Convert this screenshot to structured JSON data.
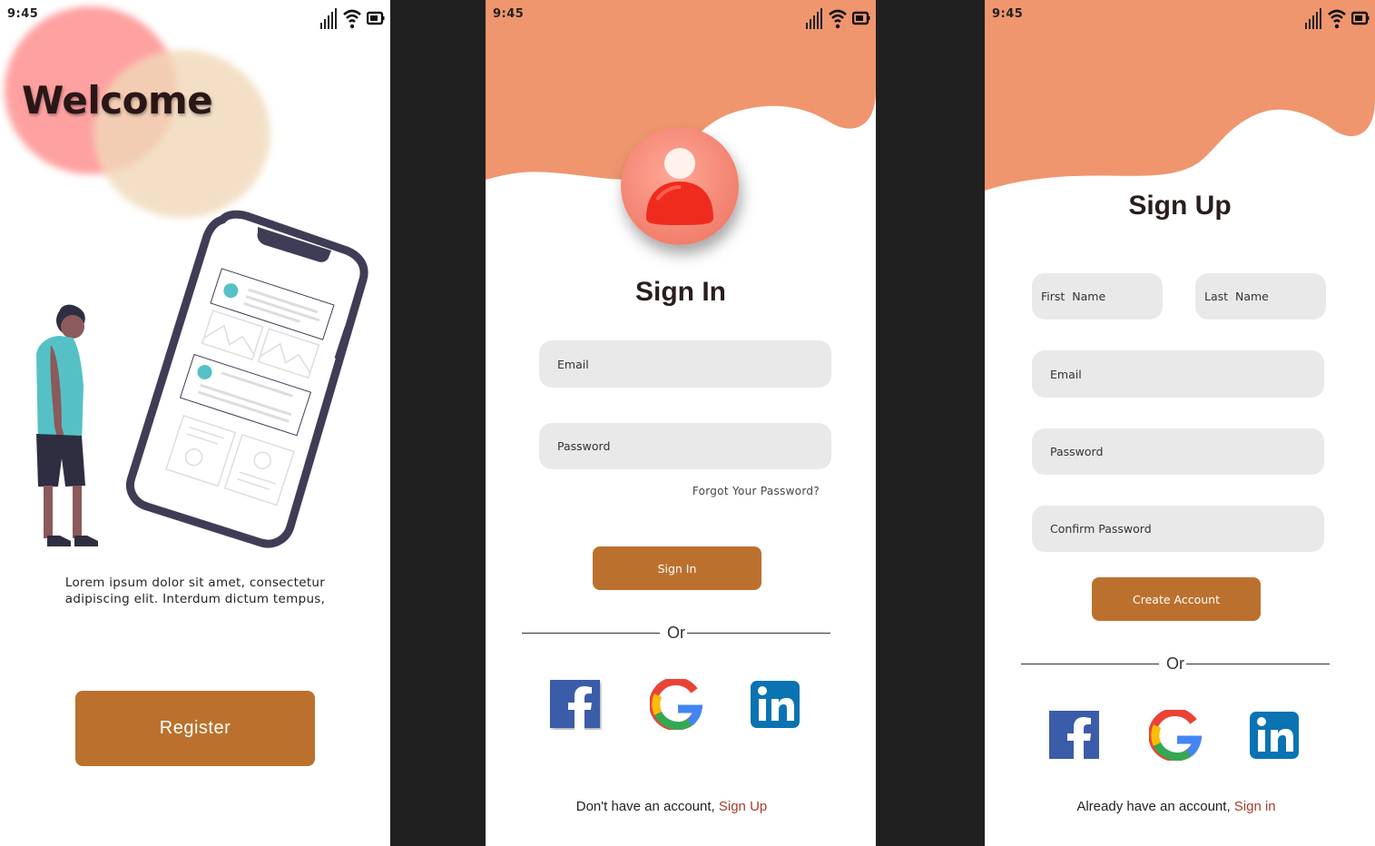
{
  "status_bar": {
    "time": "9:45"
  },
  "welcome": {
    "title": "Welcome",
    "description": "Lorem ipsum dolor sit amet, consectetur adipiscing elit. Interdum dictum tempus,",
    "register_label": "Register"
  },
  "signin": {
    "title": "Sign In",
    "email_placeholder": "Email",
    "password_placeholder": "Password",
    "forgot_label": "Forgot Your Password?",
    "submit_label": "Sign In",
    "or_label": "Or",
    "footer_text": "Don't have an account, ",
    "footer_link": "Sign Up"
  },
  "signup": {
    "title": "Sign Up",
    "first_name_placeholder": "First  Name",
    "last_name_placeholder": "Last  Name",
    "email_placeholder": "Email",
    "password_placeholder": "Password",
    "confirm_placeholder": "Confirm Password",
    "submit_label": "Create Account",
    "or_label": "Or",
    "footer_text": "Already have an account, ",
    "footer_link": "Sign in"
  },
  "social": [
    "facebook-icon",
    "google-icon",
    "linkedin-icon"
  ],
  "colors": {
    "accent": "#bb712d",
    "header_wave": "#ef966e",
    "link": "#a33d2d",
    "field_bg": "#e9e9e9",
    "backdrop": "#202020"
  }
}
